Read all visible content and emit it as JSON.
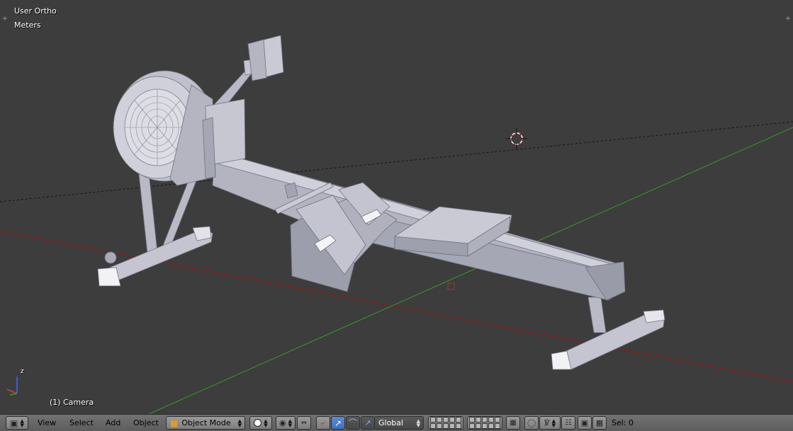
{
  "viewport": {
    "view_name": "User Ortho",
    "units": "Meters",
    "object_label": "(1) Camera",
    "axis_z_label": "z",
    "background": "#3d3d3d",
    "x_axis_color": "#8a1b1b",
    "y_axis_color": "#3c8a2a"
  },
  "header": {
    "menus": [
      "View",
      "Select",
      "Add",
      "Object"
    ],
    "mode_label": "Object Mode",
    "orientation_label": "Global",
    "selection_status": "Sel: 0",
    "icons": {
      "editor_type": "cube-icon",
      "shading": "sphere-icon",
      "pivot": "pivot-icon",
      "manipulator": "manipulator-icon",
      "translate": "translate-arrow-icon",
      "rotate": "rotate-arc-icon",
      "scale": "scale-icon",
      "layers": "layers-icon",
      "lock": "lock-icon",
      "proportional": "proportional-edit-icon",
      "snap": "magnet-icon",
      "render_opengl": "camera-icon",
      "render_anim": "clapper-icon"
    }
  }
}
